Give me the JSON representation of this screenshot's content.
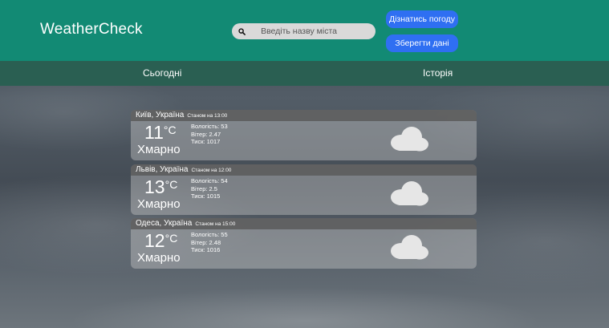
{
  "header": {
    "logo": "WeatherCheck",
    "search_placeholder": "Введіть назву міста",
    "weather_button": "Дізнатись погоду",
    "save_button": "Зберегти дані"
  },
  "nav": {
    "today": "Сьогодні",
    "history": "Історія"
  },
  "cards": [
    {
      "city": "Київ, Україна",
      "time": "Станом на 13:00",
      "temp": "11",
      "unit": "°C",
      "condition": "Хмарно",
      "humidity": "Вологість: 53",
      "wind": "Вітер: 2.47",
      "pressure": "Тиск: 1017",
      "icon": "cloud-icon"
    },
    {
      "city": "Львів, Україна",
      "time": "Станом на 12:00",
      "temp": "13",
      "unit": "°C",
      "condition": "Хмарно",
      "humidity": "Вологість: 54",
      "wind": "Вітер: 2.5",
      "pressure": "Тиск: 1015",
      "icon": "cloud-icon"
    },
    {
      "city": "Одеса, Україна",
      "time": "Станом на 15:00",
      "temp": "12",
      "unit": "°C",
      "condition": "Хмарно",
      "humidity": "Вологість: 55",
      "wind": "Вітер: 2.48",
      "pressure": "Тиск: 1016",
      "icon": "cloud-icon"
    }
  ]
}
